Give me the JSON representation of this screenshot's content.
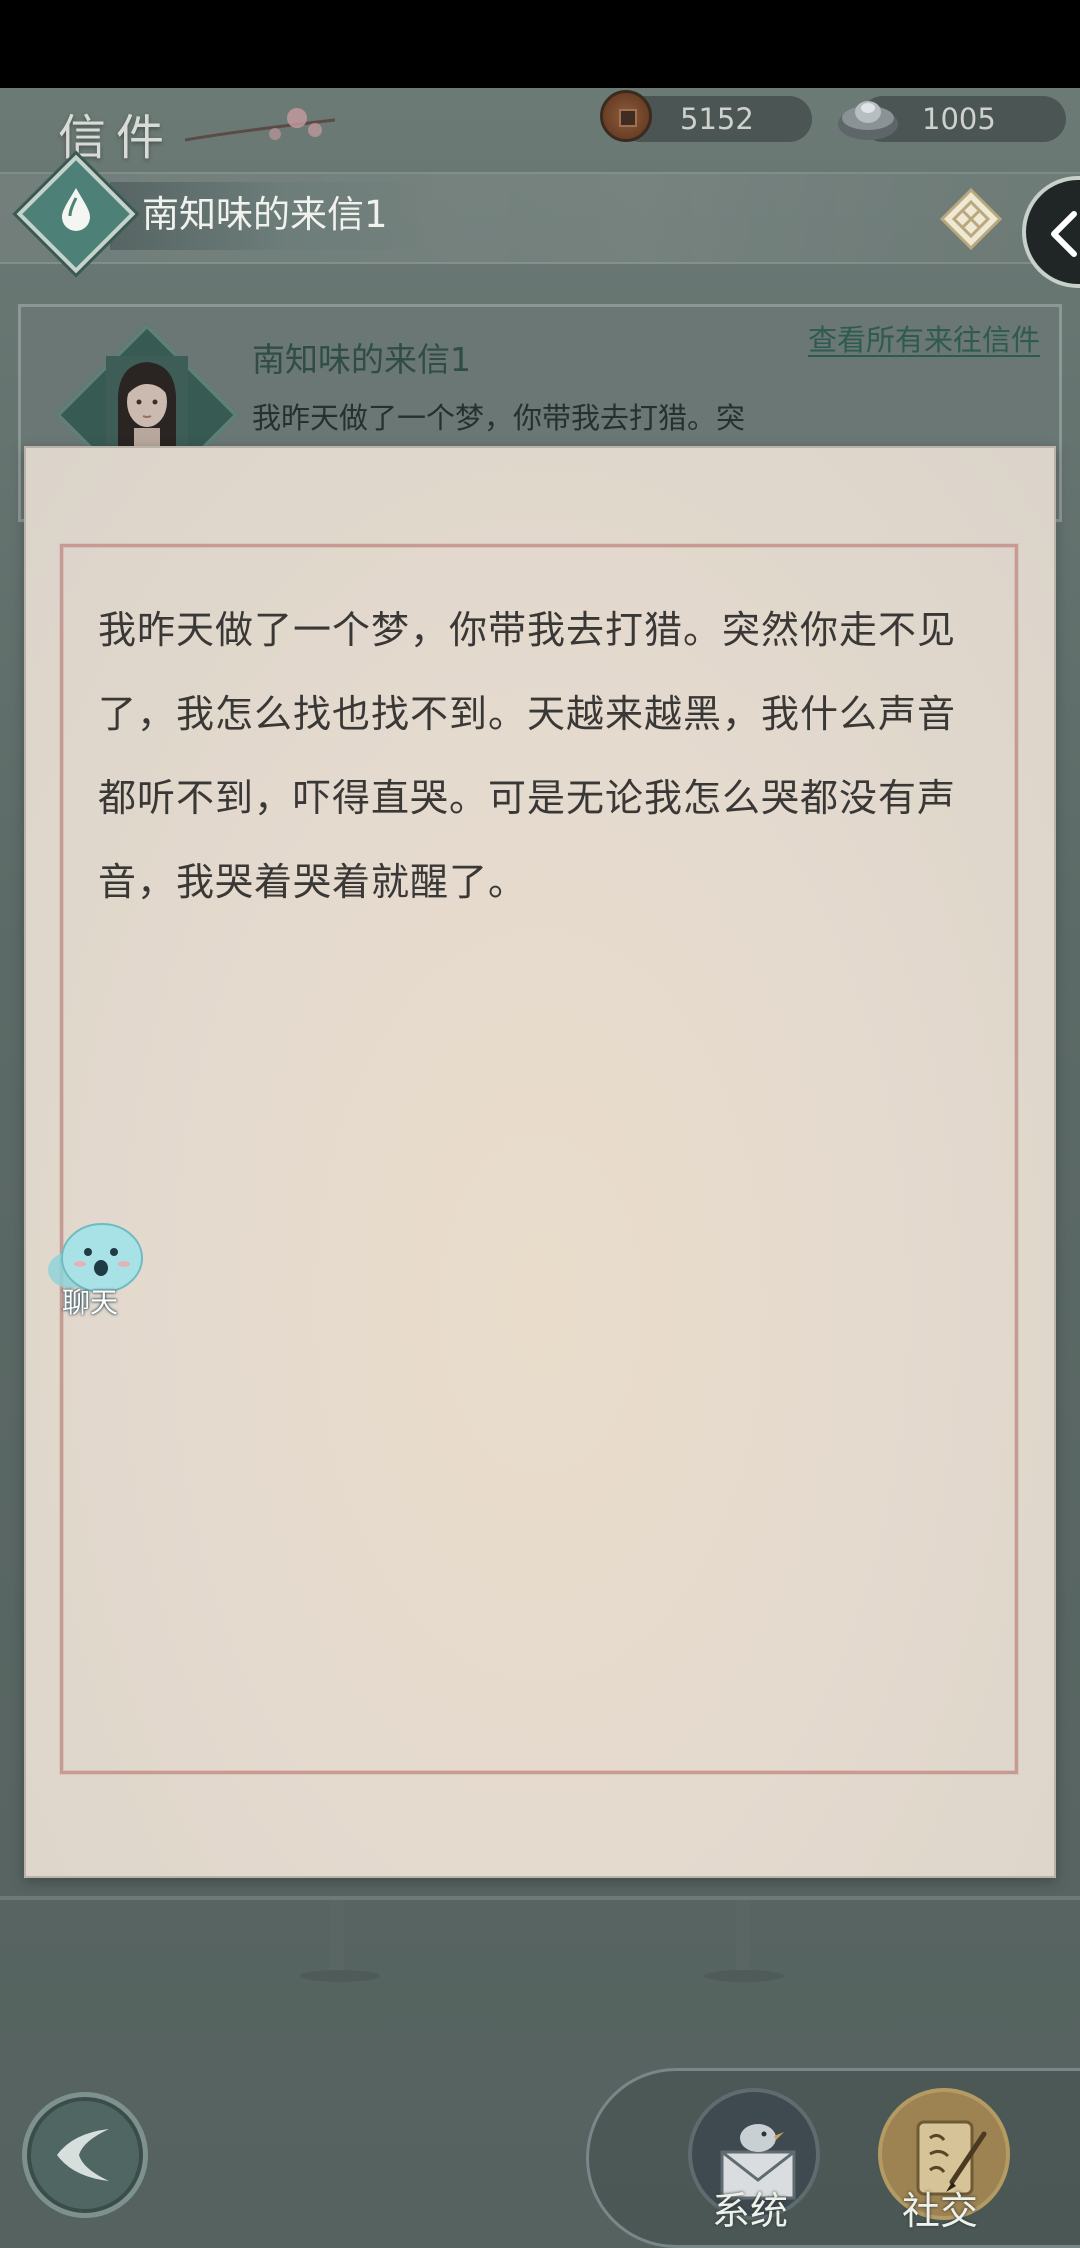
{
  "header": {
    "title": "信件",
    "coins": "5152",
    "ingots": "1005"
  },
  "letter": {
    "title": "南知味的来信1",
    "sender_name": "南知味的来信1",
    "preview": "我昨天做了一个梦，你带我去打猎。突",
    "view_all_label": "查看所有来往信件",
    "body": "我昨天做了一个梦，你带我去打猎。突然你走不见了，我怎么找也找不到。天越来越黑，我什么声音都听不到，吓得直哭。可是无论我怎么哭都没有声音，我哭着哭着就醒了。"
  },
  "chat": {
    "label": "聊天"
  },
  "dock": {
    "system_label": "系统",
    "social_label": "社交"
  },
  "icons": {
    "coin": "copper-coin-icon",
    "ingot": "silver-ingot-icon",
    "drop": "water-drop-icon",
    "menu": "diamond-menu-icon",
    "back": "chevron-left-icon",
    "mail": "bird-mail-icon",
    "social": "brush-scroll-icon"
  },
  "colors": {
    "accent_green": "#2f5a4f",
    "paper": "#e5dace",
    "paper_border": "#c79b94"
  }
}
